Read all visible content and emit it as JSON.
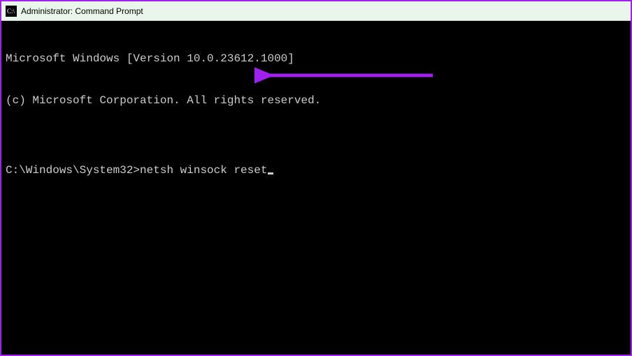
{
  "window": {
    "title": "Administrator: Command Prompt"
  },
  "terminal": {
    "line1": "Microsoft Windows [Version 10.0.23612.1000]",
    "line2": "(c) Microsoft Corporation. All rights reserved.",
    "blank": "",
    "prompt": "C:\\Windows\\System32>",
    "command": "netsh winsock reset"
  },
  "annotation": {
    "color": "#a020f0"
  }
}
